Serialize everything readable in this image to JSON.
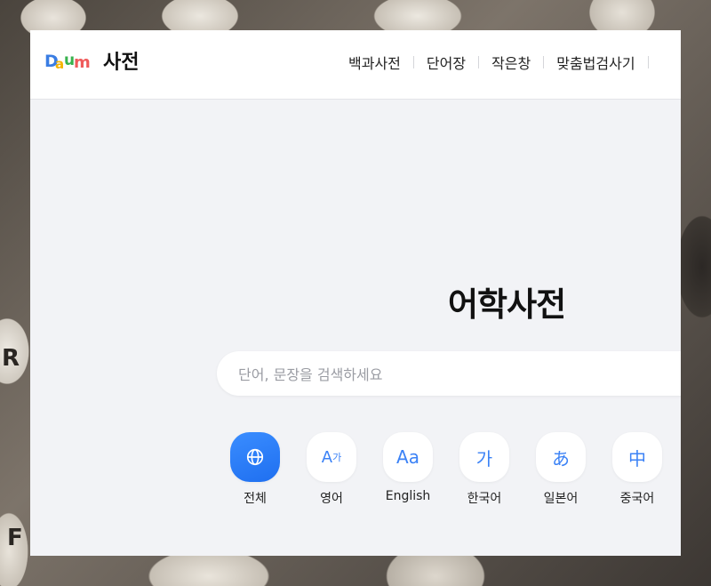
{
  "header": {
    "logo_text": "Daum",
    "service_name": "사전",
    "nav": [
      "백과사전",
      "단어장",
      "작은창",
      "맞춤법검사기"
    ]
  },
  "main": {
    "title": "어학사전",
    "search": {
      "placeholder": "단어, 문장을 검색하세요",
      "value": ""
    },
    "categories": [
      {
        "label": "전체",
        "icon": "globe-icon",
        "active": true
      },
      {
        "label": "영어",
        "icon": "A가"
      },
      {
        "label": "English",
        "icon": "Aa"
      },
      {
        "label": "한국어",
        "icon": "가"
      },
      {
        "label": "일본어",
        "icon": "あ"
      },
      {
        "label": "중국어",
        "icon": "中"
      }
    ]
  },
  "colors": {
    "accent": "#2f7bf7",
    "page_bg": "#f2f3f6",
    "logo_d": "#3a7de3",
    "logo_a": "#f5b400",
    "logo_u": "#37b24d",
    "logo_m": "#ef5b5b"
  }
}
